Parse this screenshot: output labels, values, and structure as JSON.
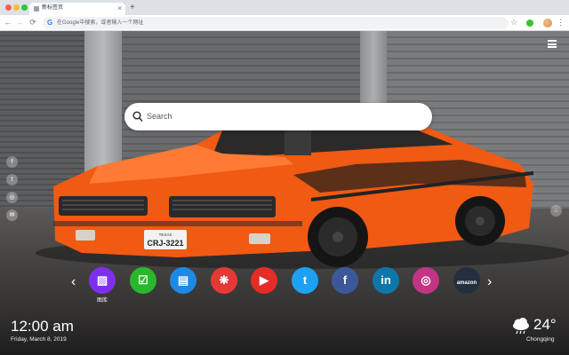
{
  "tab": {
    "title": "新标签页",
    "close": "×",
    "new_tab": "+"
  },
  "toolbar": {
    "back": "←",
    "forward": "→",
    "reload": "⟳",
    "omnibox_text": "在Google中搜索，或者输入一个网址",
    "google_glyph": "G",
    "star": "☆",
    "menu": "⋮"
  },
  "colors": {
    "accent_green": "#3ac13a",
    "car_orange": "#f05a12"
  },
  "search": {
    "placeholder": "Search"
  },
  "social": {
    "facebook": "f",
    "twitter": "t",
    "instagram": "◎",
    "email": "✉",
    "home": "⌂"
  },
  "nav": {
    "prev": "‹",
    "next": "›"
  },
  "shortcuts": [
    {
      "name": "gallery",
      "label": "图库",
      "glyph": "▨",
      "color": "#7d2ff0"
    },
    {
      "name": "tasks",
      "label": "",
      "glyph": "☑",
      "color": "#29b72b"
    },
    {
      "name": "notes",
      "label": "",
      "glyph": "▤",
      "color": "#1e88e5"
    },
    {
      "name": "game",
      "label": "",
      "glyph": "❋",
      "color": "#e53935"
    },
    {
      "name": "youtube",
      "label": "",
      "glyph": "▶",
      "color": "#e52d27"
    },
    {
      "name": "twitter",
      "label": "",
      "glyph": "t",
      "color": "#1da1f2"
    },
    {
      "name": "facebook",
      "label": "",
      "glyph": "f",
      "color": "#3b5998"
    },
    {
      "name": "linkedin",
      "label": "",
      "glyph": "in",
      "color": "#0e76a8"
    },
    {
      "name": "instagram",
      "label": "",
      "glyph": "◎",
      "color": "#c13584"
    },
    {
      "name": "amazon",
      "label": "",
      "glyph": "amazon",
      "color": "#232f3e"
    }
  ],
  "clock": {
    "time": "12:00 am",
    "date": "Friday, March 8, 2019"
  },
  "weather": {
    "temp": "24°",
    "city": "Chongqing",
    "icon": "cloud-rain"
  },
  "plate": {
    "state": "TEXAS",
    "number": "CRJ-3221"
  }
}
